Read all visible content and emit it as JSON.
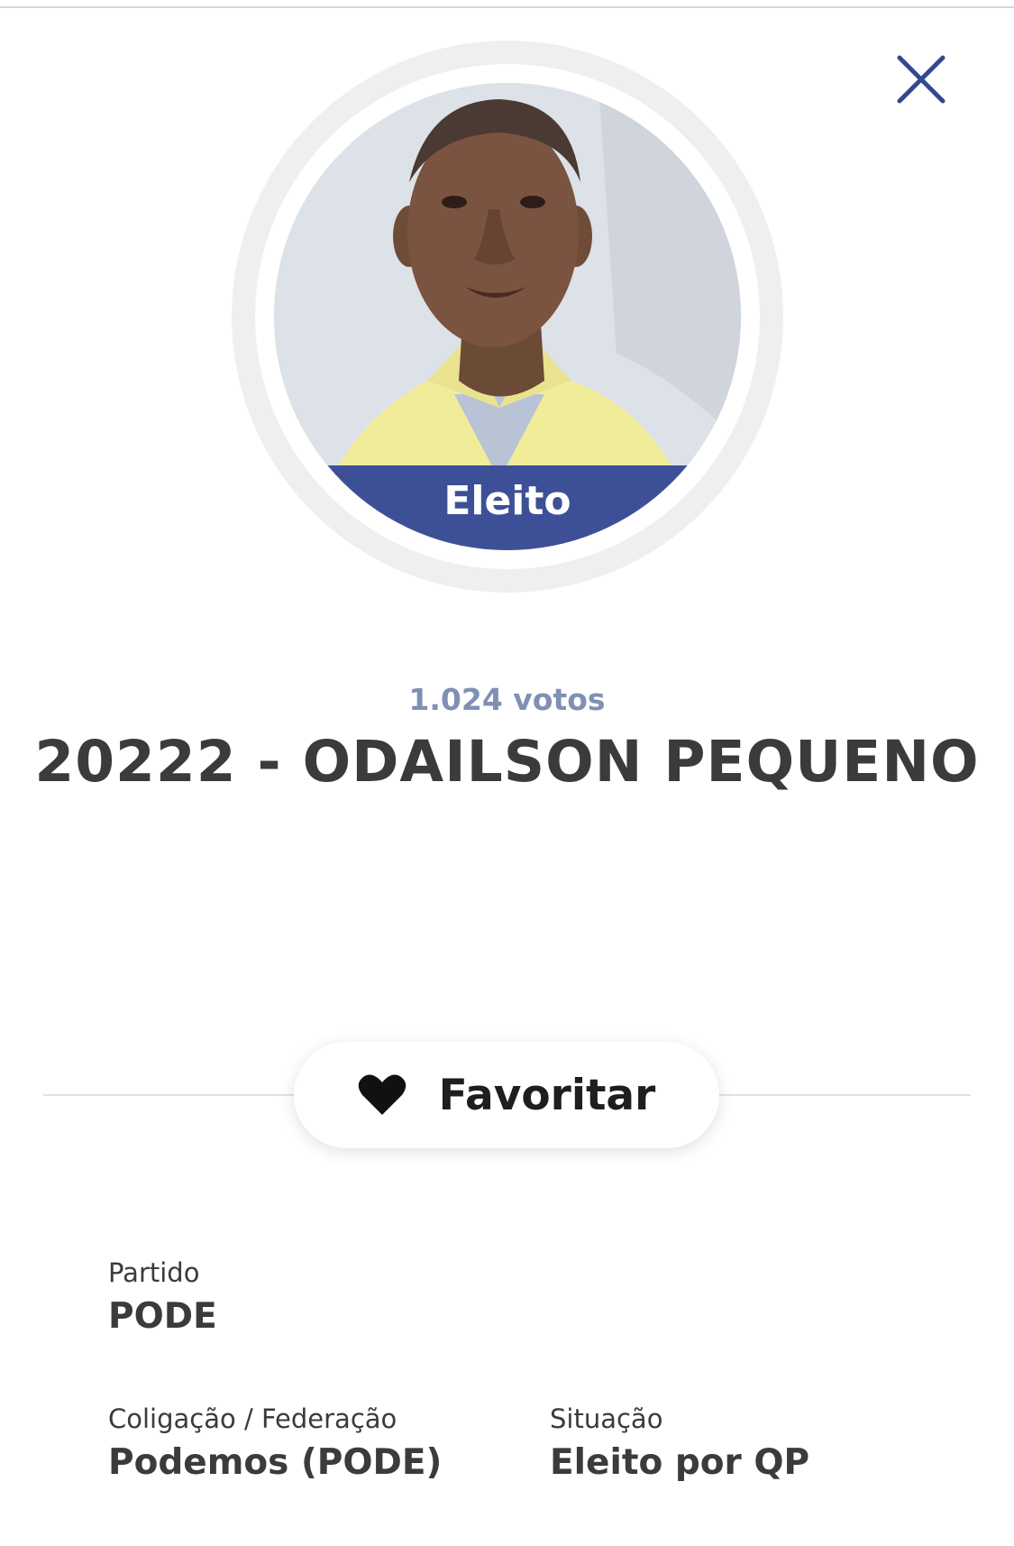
{
  "status_badge": "Eleito",
  "votes": "1.024 votos",
  "candidate_name": "20222 - ODAILSON PEQUENO",
  "favorite_label": "Favoritar",
  "info": {
    "party_label": "Partido",
    "party_value": "PODE",
    "coalition_label": "Coligação / Federação",
    "coalition_value": "Podemos (PODE)",
    "situation_label": "Situação",
    "situation_value": "Eleito por QP"
  },
  "icons": {
    "close": "close-icon",
    "favorite": "heart-icon"
  },
  "colors": {
    "accent": "#3d5097",
    "votes": "#8090b4",
    "close": "#34488f"
  }
}
